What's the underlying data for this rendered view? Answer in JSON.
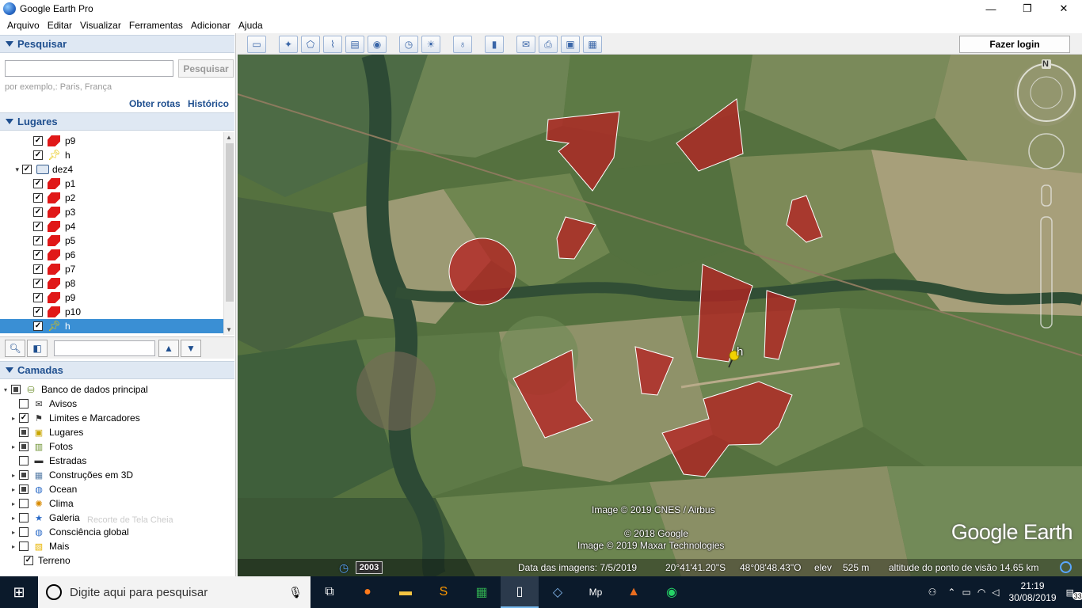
{
  "window": {
    "title": "Google Earth Pro",
    "min": "—",
    "max": "❐",
    "close": "✕"
  },
  "menu": [
    "Arquivo",
    "Editar",
    "Visualizar",
    "Ferramentas",
    "Adicionar",
    "Ajuda"
  ],
  "toolbar": {
    "icons": [
      "sidebar-icon",
      "placemark-icon",
      "polygon-icon",
      "path-icon",
      "overlay-icon",
      "record-tour-icon",
      "historical-imagery-icon",
      "sunlight-icon",
      "planets-icon",
      "ruler-icon",
      "email-icon",
      "print-icon",
      "save-image-icon",
      "view-in-maps-icon"
    ],
    "login_label": "Fazer login"
  },
  "search": {
    "header": "Pesquisar",
    "button": "Pesquisar",
    "hint": "por exemplo,: Paris, França",
    "link_routes": "Obter rotas",
    "link_history": "Histórico"
  },
  "places": {
    "header": "Lugares",
    "items": [
      {
        "label": "p9",
        "type": "polygon",
        "checked": true,
        "indent": 1
      },
      {
        "label": "h",
        "type": "pin",
        "checked": true,
        "indent": 1
      },
      {
        "label": "dez4",
        "type": "folder",
        "checked": true,
        "indent": 0
      },
      {
        "label": "p1",
        "type": "polygon",
        "checked": true,
        "indent": 1
      },
      {
        "label": "p2",
        "type": "polygon",
        "checked": true,
        "indent": 1
      },
      {
        "label": "p3",
        "type": "polygon",
        "checked": true,
        "indent": 1
      },
      {
        "label": "p4",
        "type": "polygon",
        "checked": true,
        "indent": 1
      },
      {
        "label": "p5",
        "type": "polygon",
        "checked": true,
        "indent": 1
      },
      {
        "label": "p6",
        "type": "polygon",
        "checked": true,
        "indent": 1
      },
      {
        "label": "p7",
        "type": "polygon",
        "checked": true,
        "indent": 1
      },
      {
        "label": "p8",
        "type": "polygon",
        "checked": true,
        "indent": 1
      },
      {
        "label": "p9",
        "type": "polygon",
        "checked": true,
        "indent": 1
      },
      {
        "label": "p10",
        "type": "polygon",
        "checked": true,
        "indent": 1
      },
      {
        "label": "h",
        "type": "pin",
        "checked": true,
        "indent": 1,
        "selected": true
      }
    ]
  },
  "layers": {
    "header": "Camadas",
    "items": [
      {
        "label": "Banco de dados principal",
        "checked": "partial",
        "expand": "▾",
        "icon": "database-icon"
      },
      {
        "label": "Avisos",
        "checked": "off",
        "expand": "",
        "icon": "mail-icon"
      },
      {
        "label": "Limites e Marcadores",
        "checked": "on",
        "expand": "▸",
        "icon": "flag-icon"
      },
      {
        "label": "Lugares",
        "checked": "partial",
        "expand": "",
        "icon": "places-icon"
      },
      {
        "label": "Fotos",
        "checked": "partial",
        "expand": "▸",
        "icon": "photo-icon"
      },
      {
        "label": "Estradas",
        "checked": "off",
        "expand": "",
        "icon": "road-icon"
      },
      {
        "label": "Construções em 3D",
        "checked": "partial",
        "expand": "▸",
        "icon": "building-icon"
      },
      {
        "label": "Ocean",
        "checked": "partial",
        "expand": "▸",
        "icon": "globe-icon"
      },
      {
        "label": "Clima",
        "checked": "off",
        "expand": "▸",
        "icon": "sun-icon"
      },
      {
        "label": "Galeria",
        "checked": "off",
        "expand": "▸",
        "icon": "star-icon"
      },
      {
        "label": "Consciência global",
        "checked": "off",
        "expand": "▸",
        "icon": "globe-icon"
      },
      {
        "label": "Mais",
        "checked": "off",
        "expand": "▸",
        "icon": "more-icon"
      },
      {
        "label": "Terreno",
        "checked": "on",
        "expand": "",
        "icon": ""
      }
    ],
    "ghost_text": "Recorte de Tela Cheia"
  },
  "map": {
    "pin_label": "h",
    "compass_letter": "N",
    "credit_1": "Image © 2019 CNES / Airbus",
    "credit_2": "© 2018 Google",
    "credit_3": "Image © 2019 Maxar Technologies",
    "logo": "Google Earth",
    "polygon_color": "#b52222"
  },
  "status": {
    "year": "2003",
    "imagery_date": "Data das imagens: 7/5/2019",
    "lat": "20°41'41.20\"S",
    "lon": "48°08'48.43\"O",
    "elev_label": "elev",
    "elev_value": "525 m",
    "eye_alt": "altitude do ponto de visão  14.65 km"
  },
  "taskbar": {
    "search_placeholder": "Digite aqui para pesquisar",
    "apps": [
      "task-view-icon",
      "firefox-icon",
      "file-explorer-icon",
      "sublime-icon",
      "excel-icon",
      "document-icon",
      "virtualbox-icon",
      "mp-icon",
      "matlab-icon",
      "whatsapp-icon"
    ],
    "time": "21:19",
    "date": "30/08/2019",
    "notifications": "33"
  }
}
